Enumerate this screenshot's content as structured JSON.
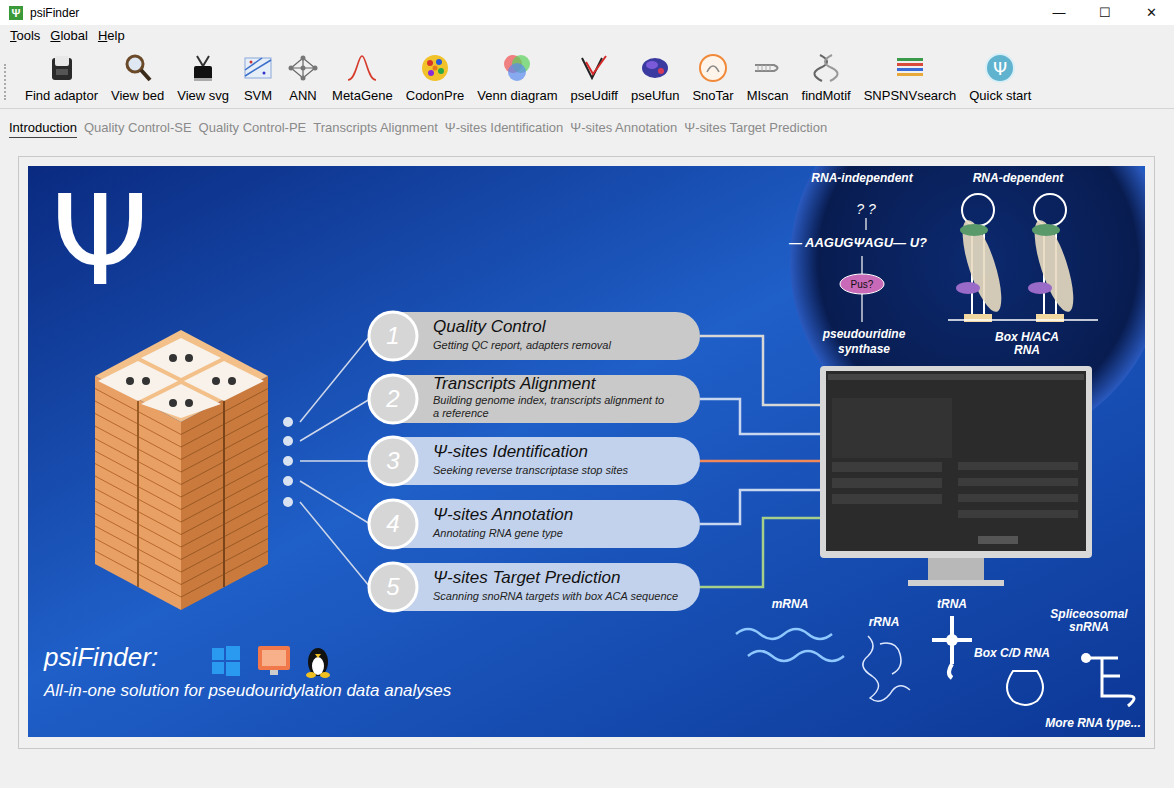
{
  "window": {
    "title": "psiFinder",
    "icon_glyph": "Ψ",
    "controls": [
      "—",
      "☐",
      "✕"
    ]
  },
  "menu": [
    "Tools",
    "Global",
    "Help"
  ],
  "toolbar": [
    {
      "label": "Find adaptor"
    },
    {
      "label": "View bed"
    },
    {
      "label": "View svg"
    },
    {
      "label": "SVM"
    },
    {
      "label": "ANN"
    },
    {
      "label": "MetaGene"
    },
    {
      "label": "CodonPre"
    },
    {
      "label": "Venn diagram"
    },
    {
      "label": "pseUdiff"
    },
    {
      "label": "pseUfun"
    },
    {
      "label": "SnoTar"
    },
    {
      "label": "MIscan"
    },
    {
      "label": "findMotif"
    },
    {
      "label": "SNPSNVsearch"
    },
    {
      "label": "Quick start",
      "glyph": "Ψ"
    }
  ],
  "tabs": [
    {
      "label": "Introduction",
      "selected": true
    },
    {
      "label": "Quality Control-SE",
      "selected": false
    },
    {
      "label": "Quality Control-PE",
      "selected": false
    },
    {
      "label": "Transcripts Alignment",
      "selected": false
    },
    {
      "label": "Ψ-sites Identification",
      "selected": false
    },
    {
      "label": "Ψ-sites Annotation",
      "selected": false
    },
    {
      "label": "Ψ-sites Target Prediction",
      "selected": false
    }
  ],
  "banner": {
    "logo": "Ψ",
    "steps": [
      {
        "number": "1",
        "title": "Quality Control",
        "subtitle": [
          "Getting QC report, adapters removal"
        ],
        "color": "#c9c9c9",
        "line_color": "#d7d7d7"
      },
      {
        "number": "2",
        "title": "Transcripts Alignment",
        "subtitle": [
          "Building genome index, transcripts alignment to",
          "a reference"
        ],
        "color": "#c9c9c9",
        "line_color": "#c8d6f0"
      },
      {
        "number": "3",
        "title": "Ψ-sites Identification",
        "subtitle": [
          "Seeking reverse transcriptase stop sites"
        ],
        "color": "#c3d2ec",
        "line_color": "#f0885a"
      },
      {
        "number": "4",
        "title": "Ψ-sites Annotation",
        "subtitle": [
          "Annotating RNA gene type"
        ],
        "color": "#c3d2ec",
        "line_color": "#c8d6f0"
      },
      {
        "number": "5",
        "title": "Ψ-sites Target Prediction",
        "subtitle": [
          "Scanning snoRNA targets with  box ACA sequence"
        ],
        "color": "#c3d2ec",
        "line_color": "#a6d08a"
      }
    ],
    "tagline": {
      "title": "psiFinder:",
      "subtitle": "All-in-one solution for pseudouridylation data analyses"
    },
    "mechanism": {
      "left_title": "RNA-independent",
      "right_title": "RNA-dependent",
      "question": "? ?",
      "sequence": "— AAGUGΨAGU— U?",
      "enzyme": "Pus?",
      "enzyme_label": [
        "pseudouridine",
        "synthase"
      ],
      "rna_label": [
        "Box H/ACA",
        "RNA"
      ]
    },
    "rna_types": [
      {
        "lines": [
          "mRNA"
        ]
      },
      {
        "lines": [
          "rRNA"
        ]
      },
      {
        "lines": [
          "tRNA"
        ]
      },
      {
        "lines": [
          "Box C/D RNA"
        ]
      },
      {
        "lines": [
          "Spliceosomal",
          "snRNA"
        ]
      },
      {
        "lines": [
          "More RNA type..."
        ]
      }
    ]
  }
}
